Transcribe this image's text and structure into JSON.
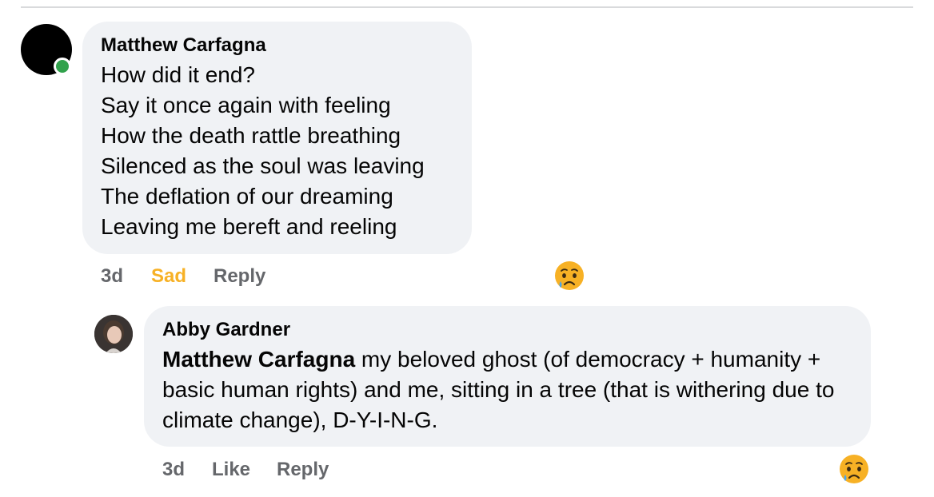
{
  "comments": [
    {
      "author": "Matthew Carfagna",
      "lines": [
        "How did it end?",
        "Say it once again with feeling",
        "How the death rattle breathing",
        "Silenced as the soul was leaving",
        "The deflation of our dreaming",
        "Leaving me bereft and reeling"
      ],
      "time": "3d",
      "reaction_label": "Sad",
      "reply_label": "Reply",
      "reaction_icon": "sad-reaction-icon",
      "online": true
    },
    {
      "author": "Abby Gardner",
      "mention": "Matthew Carfagna",
      "text": " my beloved ghost (of democracy + humanity + basic human rights) and me, sitting in a tree (that is withering due to climate change), D-Y-I-N-G.",
      "time": "3d",
      "like_label": "Like",
      "reply_label": "Reply",
      "reaction_icon": "sad-reaction-icon"
    }
  ],
  "colors": {
    "bubble": "#f0f2f5",
    "meta": "#65676b",
    "sad": "#f7b125",
    "online": "#31a24c"
  }
}
